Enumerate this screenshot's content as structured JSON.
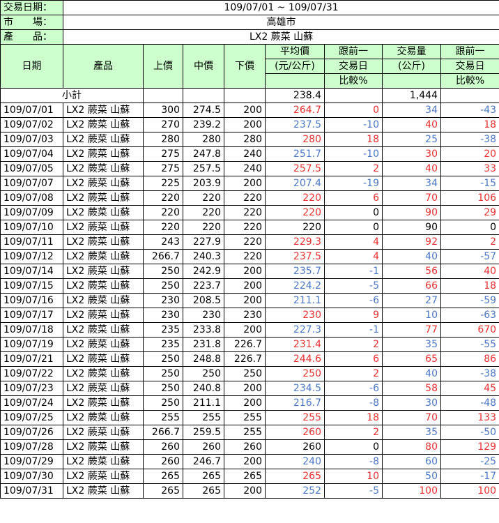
{
  "info": {
    "date_label": "交易日期：",
    "date_value": "109/07/01 ~ 109/07/31",
    "market_label": "市　　場：",
    "market_value": "高雄市",
    "product_label": "產　　品：",
    "product_value": "LX2 蕨菜 山蘇"
  },
  "headers": {
    "date": "日期",
    "product": "產品",
    "high": "上價",
    "mid": "中價",
    "low": "下價",
    "avg_l1": "平均價",
    "avg_l2": "(元/公斤)",
    "cmp1_l1": "跟前一",
    "cmp1_l2": "交易日",
    "cmp1_l3": "比較%",
    "vol_l1": "交易量",
    "vol_l2": "(公斤)",
    "cmp2_l1": "跟前一",
    "cmp2_l2": "交易日",
    "cmp2_l3": "比較%"
  },
  "subtotal": {
    "label": "小計",
    "avg": "238.4",
    "vol": "1,444"
  },
  "colors": {
    "red": "#e8302f",
    "blue": "#4a78c4",
    "header_bg": "#ccffcc"
  },
  "rows": [
    {
      "date": "109/07/01",
      "product": "LX2 蕨菜 山蘇",
      "high": "300",
      "mid": "274.5",
      "low": "200",
      "avg": "264.7",
      "avg_c": "red",
      "cmp1": "0",
      "cmp1_c": "red",
      "vol": "34",
      "vol_c": "blue",
      "cmp2": "-43",
      "cmp2_c": "blue"
    },
    {
      "date": "109/07/02",
      "product": "LX2 蕨菜 山蘇",
      "high": "270",
      "mid": "239.2",
      "low": "200",
      "avg": "237.5",
      "avg_c": "blue",
      "cmp1": "-10",
      "cmp1_c": "blue",
      "vol": "40",
      "vol_c": "red",
      "cmp2": "18",
      "cmp2_c": "red"
    },
    {
      "date": "109/07/03",
      "product": "LX2 蕨菜 山蘇",
      "high": "280",
      "mid": "280",
      "low": "280",
      "avg": "280",
      "avg_c": "red",
      "cmp1": "18",
      "cmp1_c": "red",
      "vol": "25",
      "vol_c": "blue",
      "cmp2": "-38",
      "cmp2_c": "blue"
    },
    {
      "date": "109/07/04",
      "product": "LX2 蕨菜 山蘇",
      "high": "275",
      "mid": "247.8",
      "low": "240",
      "avg": "251.7",
      "avg_c": "blue",
      "cmp1": "-10",
      "cmp1_c": "blue",
      "vol": "30",
      "vol_c": "red",
      "cmp2": "20",
      "cmp2_c": "red"
    },
    {
      "date": "109/07/05",
      "product": "LX2 蕨菜 山蘇",
      "high": "275",
      "mid": "257.5",
      "low": "240",
      "avg": "257.5",
      "avg_c": "red",
      "cmp1": "2",
      "cmp1_c": "red",
      "vol": "40",
      "vol_c": "red",
      "cmp2": "33",
      "cmp2_c": "red"
    },
    {
      "date": "109/07/07",
      "product": "LX2 蕨菜 山蘇",
      "high": "225",
      "mid": "203.9",
      "low": "200",
      "avg": "207.4",
      "avg_c": "blue",
      "cmp1": "-19",
      "cmp1_c": "blue",
      "vol": "34",
      "vol_c": "blue",
      "cmp2": "-15",
      "cmp2_c": "blue"
    },
    {
      "date": "109/07/08",
      "product": "LX2 蕨菜 山蘇",
      "high": "220",
      "mid": "220",
      "low": "220",
      "avg": "220",
      "avg_c": "red",
      "cmp1": "6",
      "cmp1_c": "red",
      "vol": "70",
      "vol_c": "red",
      "cmp2": "106",
      "cmp2_c": "red"
    },
    {
      "date": "109/07/09",
      "product": "LX2 蕨菜 山蘇",
      "high": "220",
      "mid": "220",
      "low": "220",
      "avg": "220",
      "avg_c": "red",
      "cmp1": "0",
      "cmp1_c": "black",
      "vol": "90",
      "vol_c": "red",
      "cmp2": "29",
      "cmp2_c": "red"
    },
    {
      "date": "109/07/10",
      "product": "LX2 蕨菜 山蘇",
      "high": "220",
      "mid": "220",
      "low": "220",
      "avg": "220",
      "avg_c": "black",
      "cmp1": "0",
      "cmp1_c": "black",
      "vol": "90",
      "vol_c": "black",
      "cmp2": "0",
      "cmp2_c": "black"
    },
    {
      "date": "109/07/11",
      "product": "LX2 蕨菜 山蘇",
      "high": "243",
      "mid": "227.9",
      "low": "220",
      "avg": "229.3",
      "avg_c": "red",
      "cmp1": "4",
      "cmp1_c": "red",
      "vol": "92",
      "vol_c": "red",
      "cmp2": "2",
      "cmp2_c": "red"
    },
    {
      "date": "109/07/12",
      "product": "LX2 蕨菜 山蘇",
      "high": "266.7",
      "mid": "240.3",
      "low": "220",
      "avg": "237.5",
      "avg_c": "red",
      "cmp1": "4",
      "cmp1_c": "red",
      "vol": "40",
      "vol_c": "blue",
      "cmp2": "-57",
      "cmp2_c": "blue"
    },
    {
      "date": "109/07/14",
      "product": "LX2 蕨菜 山蘇",
      "high": "250",
      "mid": "242.9",
      "low": "200",
      "avg": "235.7",
      "avg_c": "blue",
      "cmp1": "-1",
      "cmp1_c": "blue",
      "vol": "56",
      "vol_c": "red",
      "cmp2": "40",
      "cmp2_c": "red"
    },
    {
      "date": "109/07/15",
      "product": "LX2 蕨菜 山蘇",
      "high": "250",
      "mid": "223.7",
      "low": "200",
      "avg": "224.2",
      "avg_c": "blue",
      "cmp1": "-5",
      "cmp1_c": "blue",
      "vol": "66",
      "vol_c": "red",
      "cmp2": "18",
      "cmp2_c": "red"
    },
    {
      "date": "109/07/16",
      "product": "LX2 蕨菜 山蘇",
      "high": "230",
      "mid": "208.5",
      "low": "200",
      "avg": "211.1",
      "avg_c": "blue",
      "cmp1": "-6",
      "cmp1_c": "blue",
      "vol": "27",
      "vol_c": "blue",
      "cmp2": "-59",
      "cmp2_c": "blue"
    },
    {
      "date": "109/07/17",
      "product": "LX2 蕨菜 山蘇",
      "high": "230",
      "mid": "230",
      "low": "230",
      "avg": "230",
      "avg_c": "red",
      "cmp1": "9",
      "cmp1_c": "red",
      "vol": "10",
      "vol_c": "blue",
      "cmp2": "-63",
      "cmp2_c": "blue"
    },
    {
      "date": "109/07/18",
      "product": "LX2 蕨菜 山蘇",
      "high": "235",
      "mid": "233.8",
      "low": "200",
      "avg": "227.3",
      "avg_c": "blue",
      "cmp1": "-1",
      "cmp1_c": "blue",
      "vol": "77",
      "vol_c": "red",
      "cmp2": "670",
      "cmp2_c": "red"
    },
    {
      "date": "109/07/19",
      "product": "LX2 蕨菜 山蘇",
      "high": "235",
      "mid": "231.8",
      "low": "226.7",
      "avg": "231.4",
      "avg_c": "red",
      "cmp1": "2",
      "cmp1_c": "red",
      "vol": "35",
      "vol_c": "blue",
      "cmp2": "-55",
      "cmp2_c": "blue"
    },
    {
      "date": "109/07/21",
      "product": "LX2 蕨菜 山蘇",
      "high": "250",
      "mid": "248.8",
      "low": "226.7",
      "avg": "244.6",
      "avg_c": "red",
      "cmp1": "6",
      "cmp1_c": "red",
      "vol": "65",
      "vol_c": "red",
      "cmp2": "86",
      "cmp2_c": "red"
    },
    {
      "date": "109/07/22",
      "product": "LX2 蕨菜 山蘇",
      "high": "250",
      "mid": "250",
      "low": "250",
      "avg": "250",
      "avg_c": "red",
      "cmp1": "2",
      "cmp1_c": "red",
      "vol": "40",
      "vol_c": "blue",
      "cmp2": "-38",
      "cmp2_c": "blue"
    },
    {
      "date": "109/07/23",
      "product": "LX2 蕨菜 山蘇",
      "high": "250",
      "mid": "240.8",
      "low": "200",
      "avg": "234.5",
      "avg_c": "blue",
      "cmp1": "-6",
      "cmp1_c": "blue",
      "vol": "58",
      "vol_c": "red",
      "cmp2": "45",
      "cmp2_c": "red"
    },
    {
      "date": "109/07/24",
      "product": "LX2 蕨菜 山蘇",
      "high": "250",
      "mid": "211.1",
      "low": "200",
      "avg": "216.7",
      "avg_c": "blue",
      "cmp1": "-8",
      "cmp1_c": "blue",
      "vol": "30",
      "vol_c": "blue",
      "cmp2": "-48",
      "cmp2_c": "blue"
    },
    {
      "date": "109/07/25",
      "product": "LX2 蕨菜 山蘇",
      "high": "255",
      "mid": "255",
      "low": "255",
      "avg": "255",
      "avg_c": "red",
      "cmp1": "18",
      "cmp1_c": "red",
      "vol": "70",
      "vol_c": "red",
      "cmp2": "133",
      "cmp2_c": "red"
    },
    {
      "date": "109/07/26",
      "product": "LX2 蕨菜 山蘇",
      "high": "266.7",
      "mid": "259.5",
      "low": "255",
      "avg": "260",
      "avg_c": "red",
      "cmp1": "2",
      "cmp1_c": "red",
      "vol": "35",
      "vol_c": "blue",
      "cmp2": "-50",
      "cmp2_c": "blue"
    },
    {
      "date": "109/07/28",
      "product": "LX2 蕨菜 山蘇",
      "high": "260",
      "mid": "260",
      "low": "260",
      "avg": "260",
      "avg_c": "black",
      "cmp1": "0",
      "cmp1_c": "black",
      "vol": "80",
      "vol_c": "red",
      "cmp2": "129",
      "cmp2_c": "red"
    },
    {
      "date": "109/07/29",
      "product": "LX2 蕨菜 山蘇",
      "high": "260",
      "mid": "246.7",
      "low": "200",
      "avg": "240",
      "avg_c": "blue",
      "cmp1": "-8",
      "cmp1_c": "blue",
      "vol": "60",
      "vol_c": "blue",
      "cmp2": "-25",
      "cmp2_c": "blue"
    },
    {
      "date": "109/07/30",
      "product": "LX2 蕨菜 山蘇",
      "high": "265",
      "mid": "265",
      "low": "265",
      "avg": "265",
      "avg_c": "red",
      "cmp1": "10",
      "cmp1_c": "red",
      "vol": "50",
      "vol_c": "blue",
      "cmp2": "-17",
      "cmp2_c": "blue"
    },
    {
      "date": "109/07/31",
      "product": "LX2 蕨菜 山蘇",
      "high": "265",
      "mid": "265",
      "low": "200",
      "avg": "252",
      "avg_c": "blue",
      "cmp1": "-5",
      "cmp1_c": "blue",
      "vol": "100",
      "vol_c": "red",
      "cmp2": "100",
      "cmp2_c": "red"
    }
  ]
}
